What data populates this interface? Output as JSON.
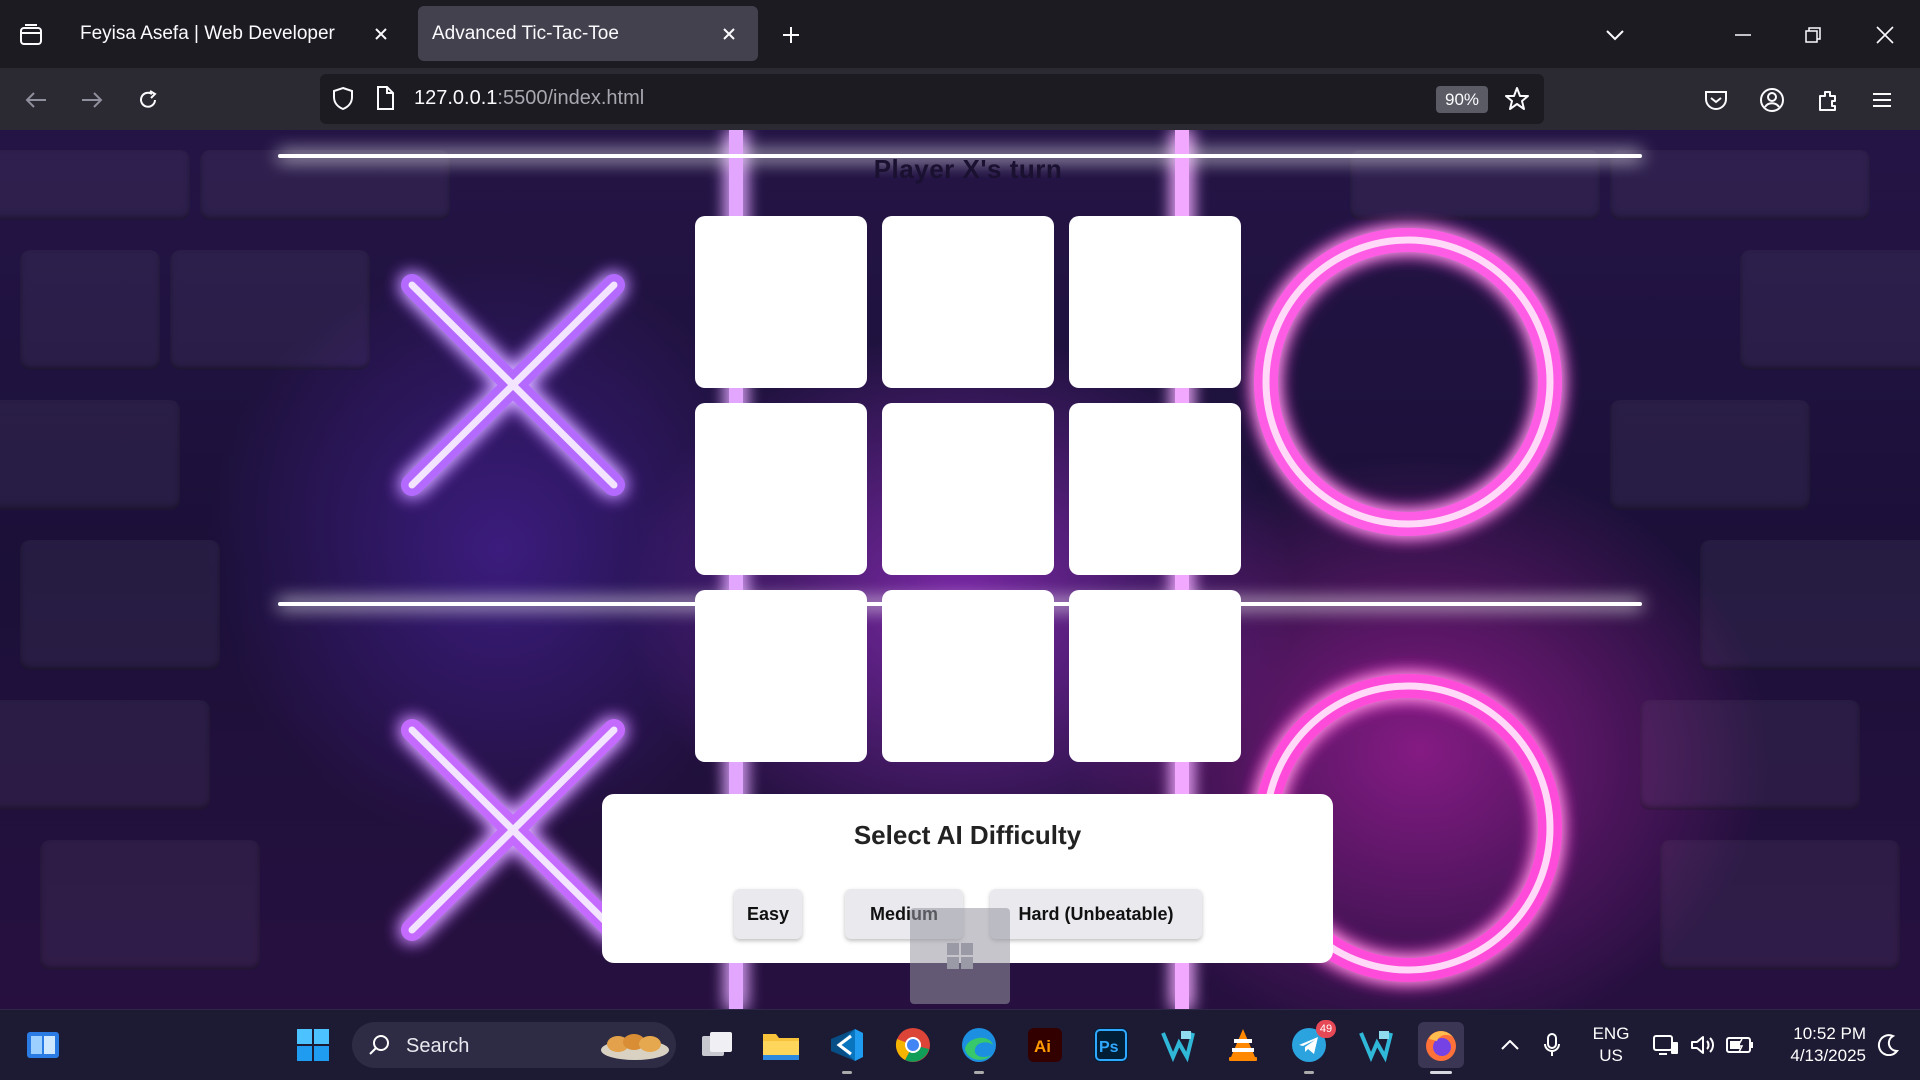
{
  "browser": {
    "tabs": [
      {
        "title": "Feyisa Asefa | Web Developer",
        "active": false
      },
      {
        "title": "Advanced Tic-Tac-Toe",
        "active": true
      }
    ],
    "url_host": "127.0.0.1",
    "url_path": ":5500/index.html",
    "zoom": "90%"
  },
  "game": {
    "status": "Player X's turn",
    "cells": [
      "",
      "",
      "",
      "",
      "",
      "",
      "",
      "",
      ""
    ]
  },
  "difficulty": {
    "heading": "Select AI Difficulty",
    "buttons": [
      "Easy",
      "Medium",
      "Hard (Unbeatable)"
    ]
  },
  "taskbar": {
    "search_label": "Search",
    "language_line1": "ENG",
    "language_line2": "US",
    "time": "10:52 PM",
    "date": "4/13/2025",
    "telegram_badge": "49"
  },
  "colors": {
    "accent_purple": "#b23bff",
    "accent_pink": "#ff3bd8",
    "browser_bg": "#1c1b22"
  }
}
